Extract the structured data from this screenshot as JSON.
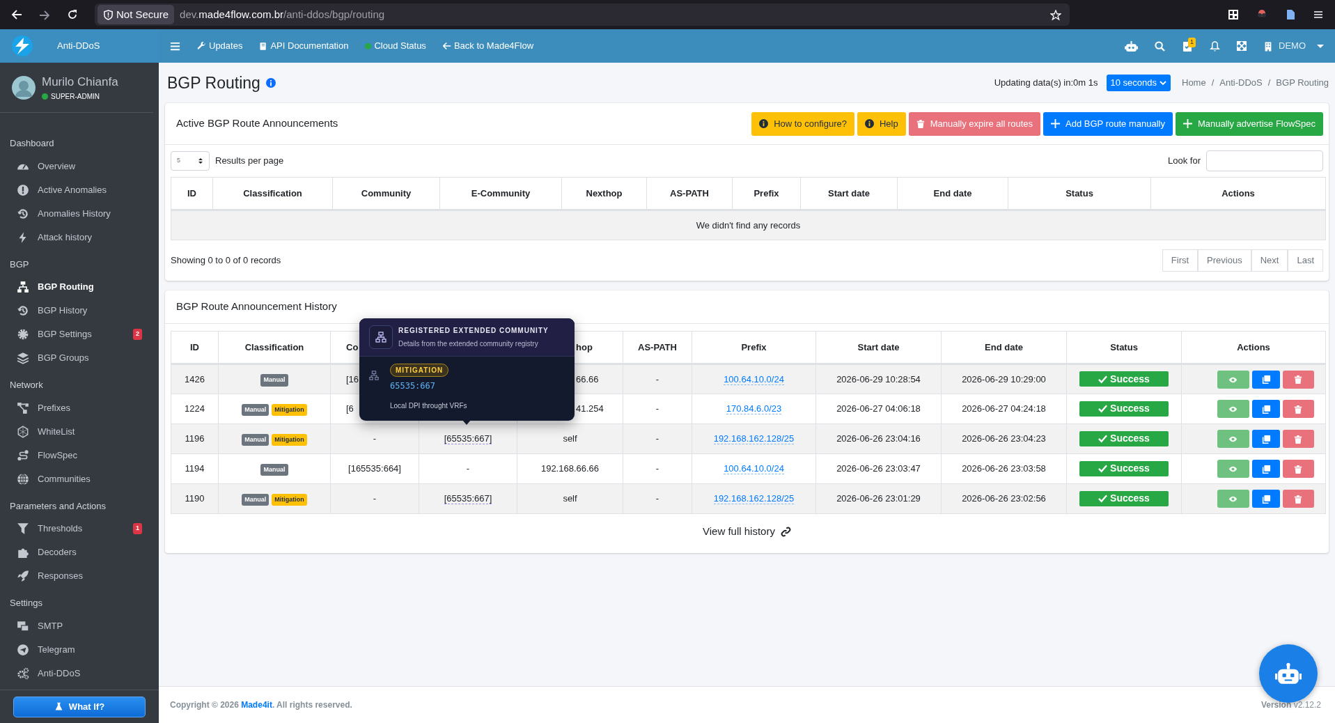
{
  "browser": {
    "security": "Not Secure",
    "url_prefix": "dev.",
    "url_domain": "made4flow.com.br",
    "url_path": "/anti-ddos/bgp/routing"
  },
  "brand": {
    "name": "Anti-DDoS"
  },
  "topnav": {
    "links": [
      "Updates",
      "API Documentation",
      "Cloud Status",
      "Back to Made4Flow"
    ],
    "tasks_badge": "1",
    "account": "DEMO"
  },
  "user": {
    "name": "Murilo Chianfa",
    "role": "SUPER-ADMIN"
  },
  "sidebar": {
    "sections": [
      {
        "title": "Dashboard",
        "items": [
          {
            "label": "Overview",
            "selected": false
          },
          {
            "label": "Active Anomalies",
            "selected": false
          },
          {
            "label": "Anomalies History",
            "selected": false
          },
          {
            "label": "Attack history",
            "selected": false
          }
        ]
      },
      {
        "title": "BGP",
        "items": [
          {
            "label": "BGP Routing",
            "selected": true
          },
          {
            "label": "BGP History",
            "selected": false
          },
          {
            "label": "BGP Settings",
            "selected": false,
            "badge": "2"
          },
          {
            "label": "BGP Groups",
            "selected": false
          }
        ]
      },
      {
        "title": "Network",
        "items": [
          {
            "label": "Prefixes",
            "selected": false
          },
          {
            "label": "WhiteList",
            "selected": false
          },
          {
            "label": "FlowSpec",
            "selected": false
          },
          {
            "label": "Communities",
            "selected": false
          }
        ]
      },
      {
        "title": "Parameters and Actions",
        "items": [
          {
            "label": "Thresholds",
            "selected": false,
            "badge": "1"
          },
          {
            "label": "Decoders",
            "selected": false
          },
          {
            "label": "Responses",
            "selected": false
          }
        ]
      },
      {
        "title": "Settings",
        "items": [
          {
            "label": "SMTP",
            "selected": false
          },
          {
            "label": "Telegram",
            "selected": false
          },
          {
            "label": "Anti-DDoS",
            "selected": false
          }
        ]
      }
    ],
    "what_if": "What If?"
  },
  "header": {
    "title": "BGP Routing",
    "updating": "Updating data(s) in:0m 1s",
    "interval": "10 seconds",
    "breadcrumb": [
      "Home",
      "Anti-DDoS",
      "BGP Routing"
    ],
    "breadcrumb_separator": "/"
  },
  "active": {
    "title": "Active BGP Route Announcements",
    "buttons": [
      {
        "label": "How to configure?",
        "kind": "warning"
      },
      {
        "label": "Help",
        "kind": "warning"
      },
      {
        "label": "Manually expire all routes",
        "kind": "danger"
      },
      {
        "label": "Add BGP route manually",
        "kind": "primary"
      },
      {
        "label": "Manually advertise FlowSpec",
        "kind": "success"
      }
    ],
    "per_page": "5",
    "per_page_label": "Results per page",
    "search_label": "Look for",
    "columns": [
      "ID",
      "Classification",
      "Community",
      "E-Community",
      "Nexthop",
      "AS-PATH",
      "Prefix",
      "Start date",
      "End date",
      "Status",
      "Actions"
    ],
    "empty": "We didn't find any records",
    "info": "Showing 0 to 0 of 0 records",
    "pager": [
      "First",
      "Previous",
      "Next",
      "Last"
    ]
  },
  "history": {
    "title": "BGP Route Announcement History",
    "columns": [
      "ID",
      "Classification",
      "Co",
      "",
      "hop",
      "AS-PATH",
      "Prefix",
      "Start date",
      "End date",
      "Status",
      "Actions"
    ],
    "rows": [
      {
        "id": "1426",
        "under_tooltip": true,
        "tags": [
          {
            "label": "Manual",
            "kind": "manual"
          }
        ],
        "community": "[16",
        "nexthop": "66.66",
        "as_path": "-",
        "prefix": "100.64.10.0/24",
        "start": "2026-06-29 10:28:54",
        "end": "2026-06-29 10:29:00",
        "status": "Success"
      },
      {
        "id": "1224",
        "under_tooltip": true,
        "tags": [
          {
            "label": "Manual",
            "kind": "manual"
          },
          {
            "label": "Mitigation",
            "kind": "mitigation"
          }
        ],
        "community": "[6",
        "nexthop": "41.254",
        "as_path": "-",
        "prefix": "170.84.6.0/23",
        "start": "2026-06-27 04:06:18",
        "end": "2026-06-27 04:24:18",
        "status": "Success"
      },
      {
        "id": "1196",
        "under_tooltip": false,
        "tags": [
          {
            "label": "Manual",
            "kind": "manual"
          },
          {
            "label": "Mitigation",
            "kind": "mitigation"
          }
        ],
        "community": "-",
        "ecommunity": "[65535:667]",
        "nexthop": "self",
        "as_path": "-",
        "prefix": "192.168.162.128/25",
        "start": "2026-06-26 23:04:16",
        "end": "2026-06-26 23:04:23",
        "status": "Success"
      },
      {
        "id": "1194",
        "under_tooltip": false,
        "tags": [
          {
            "label": "Manual",
            "kind": "manual"
          }
        ],
        "community": "[165535:664]",
        "ecommunity": "-",
        "nexthop": "192.168.66.66",
        "as_path": "-",
        "prefix": "100.64.10.0/24",
        "start": "2026-06-26 23:03:47",
        "end": "2026-06-26 23:03:58",
        "status": "Success"
      },
      {
        "id": "1190",
        "under_tooltip": false,
        "tags": [
          {
            "label": "Manual",
            "kind": "manual"
          },
          {
            "label": "Mitigation",
            "kind": "mitigation"
          }
        ],
        "community": "-",
        "ecommunity": "[65535:667]",
        "nexthop": "self",
        "as_path": "-",
        "prefix": "192.168.162.128/25",
        "start": "2026-06-26 23:01:29",
        "end": "2026-06-26 23:02:56",
        "status": "Success"
      }
    ],
    "tooltip": {
      "title": "REGISTERED EXTENDED COMMUNITY",
      "subtitle": "Details from the extended community registry",
      "tag": "MITIGATION",
      "value": "65535:667",
      "description": "Local DPI throught VRFs"
    },
    "view_full": "View full history"
  },
  "footer": {
    "before": "Copyright © 2026 ",
    "link": "Made4it",
    "after": ". All rights reserved.",
    "version_label": "Version",
    "version": "v2.12.2"
  }
}
